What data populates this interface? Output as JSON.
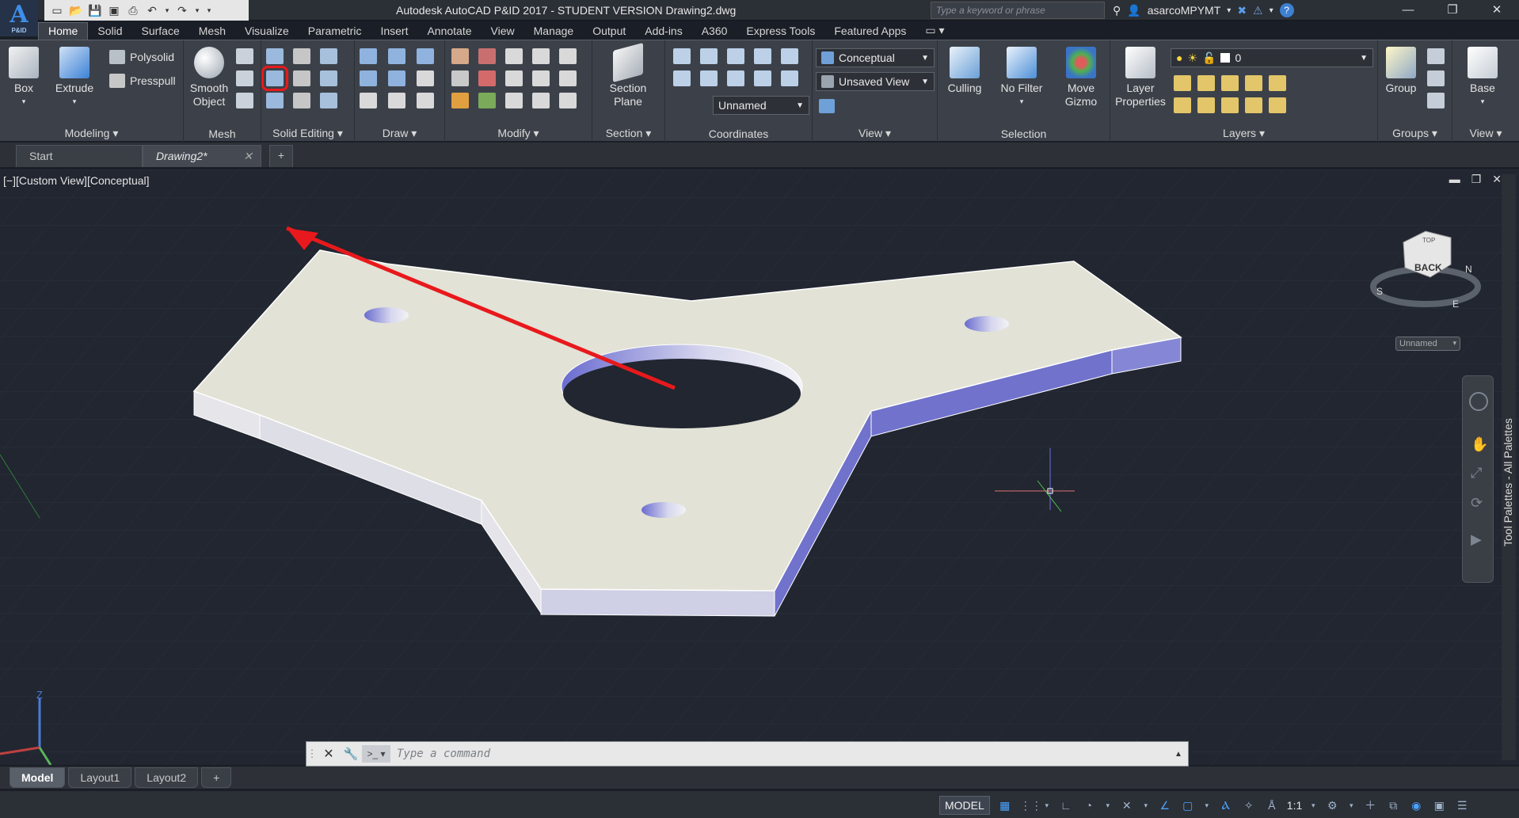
{
  "app": {
    "logo_big": "A",
    "logo_small": "P&ID",
    "title": "Autodesk AutoCAD P&ID 2017 - STUDENT VERSION    Drawing2.dwg",
    "search_placeholder": "Type a keyword or phrase",
    "user": "asarcoMPYMT"
  },
  "ribbon_tabs": [
    "Home",
    "Solid",
    "Surface",
    "Mesh",
    "Visualize",
    "Parametric",
    "Insert",
    "Annotate",
    "View",
    "Manage",
    "Output",
    "Add-ins",
    "A360",
    "Express Tools",
    "Featured Apps"
  ],
  "panels": {
    "modeling": {
      "title": "Modeling ▾",
      "box": "Box",
      "extrude": "Extrude",
      "polysolid": "Polysolid",
      "presspull": "Presspull"
    },
    "mesh": {
      "title": "Mesh",
      "smooth_line1": "Smooth",
      "smooth_line2": "Object"
    },
    "solid_editing": {
      "title": "Solid Editing ▾"
    },
    "draw": {
      "title": "Draw ▾"
    },
    "modify": {
      "title": "Modify ▾"
    },
    "section": {
      "title": "Section ▾",
      "plane_line1": "Section",
      "plane_line2": "Plane"
    },
    "coordinates": {
      "title": "Coordinates",
      "ucs_dropdown": "Unnamed"
    },
    "view": {
      "title": "View ▾",
      "visual_style": "Conceptual",
      "saved_view": "Unsaved View"
    },
    "selection": {
      "title": "Selection",
      "culling": "Culling",
      "no_filter": "No Filter",
      "move_line1": "Move",
      "move_line2": "Gizmo"
    },
    "layers": {
      "title": "Layers ▾",
      "props_line1": "Layer",
      "props_line2": "Properties",
      "current_layer": "0"
    },
    "groups": {
      "title": "Groups ▾",
      "group": "Group"
    },
    "view2": {
      "title": "View ▾",
      "base": "Base"
    }
  },
  "file_tabs": [
    {
      "label": "Start"
    },
    {
      "label": "Drawing2*"
    }
  ],
  "viewport": {
    "label": "[−][Custom View][Conceptual]",
    "viewcube_face": "BACK",
    "viewcube_top": "TOP",
    "compass": {
      "n": "N",
      "e": "E",
      "s": "S"
    },
    "ucs_name": "Unnamed",
    "axis_z": "Z"
  },
  "command_line": {
    "placeholder": "Type a command"
  },
  "layout_tabs": [
    "Model",
    "Layout1",
    "Layout2"
  ],
  "tool_palettes_label": "Tool Palettes - All Palettes",
  "status_bar": {
    "model": "MODEL",
    "scale": "1:1"
  },
  "colors": {
    "highlight": "#e8191c",
    "arrow": "#e8191c",
    "part_top": "#e2e2d6",
    "part_side": "#7072cc"
  }
}
